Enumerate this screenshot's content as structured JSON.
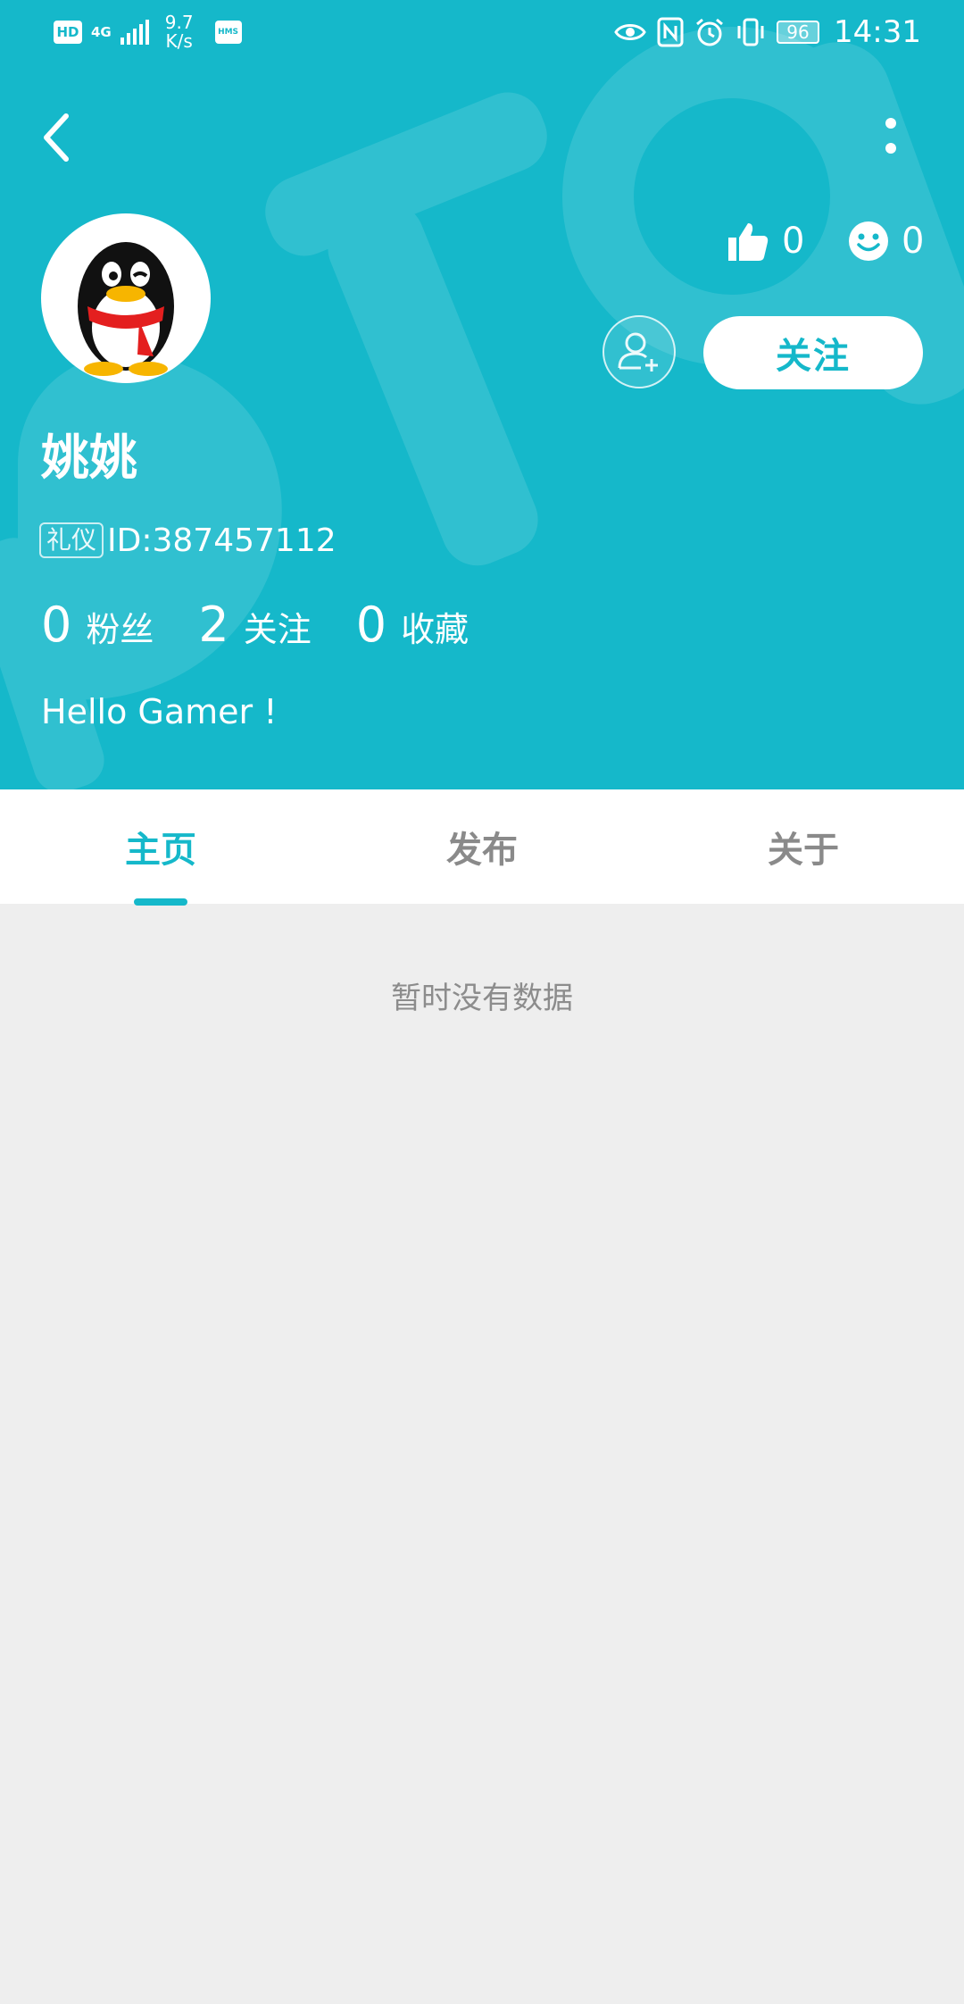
{
  "status_bar": {
    "hd": "HD",
    "network": "4G",
    "speed_value": "9.7",
    "speed_unit": "K/s",
    "hms": "HMS",
    "battery": "96",
    "time": "14:31"
  },
  "colors": {
    "accent": "#15b8ca",
    "page_background": "#eeeeee"
  },
  "header": {
    "back_icon": "chevron-left-icon",
    "more_icon": "more-vertical-icon",
    "likes_count": "0",
    "smiles_count": "0",
    "follow_label": "关注",
    "username": "姚姚",
    "tag": "礼仪",
    "user_id": "ID:387457112",
    "bio": "Hello Gamer !"
  },
  "stats": [
    {
      "count": "0",
      "label": "粉丝"
    },
    {
      "count": "2",
      "label": "关注"
    },
    {
      "count": "0",
      "label": "收藏"
    }
  ],
  "tabs": [
    {
      "label": "主页",
      "active": true
    },
    {
      "label": "发布",
      "active": false
    },
    {
      "label": "关于",
      "active": false
    }
  ],
  "content": {
    "empty_text": "暂时没有数据"
  }
}
